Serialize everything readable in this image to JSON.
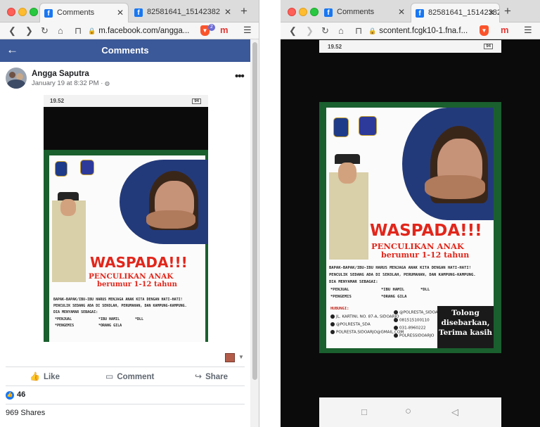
{
  "left_window": {
    "tabs": [
      {
        "label": "Comments",
        "active": true
      },
      {
        "label": "82581641_15142382",
        "active": false
      }
    ],
    "url": "m.facebook.com/angga...",
    "brave_badge": "2",
    "header_title": "Comments",
    "post": {
      "author": "Angga Saputra",
      "date": "January 19 at 8:32 PM",
      "date_separator": "·"
    },
    "actions": {
      "like": "Like",
      "comment": "Comment",
      "share": "Share"
    },
    "like_count": "46",
    "shares": "969 Shares"
  },
  "right_window": {
    "tabs": [
      {
        "label": "Comments",
        "active": false
      },
      {
        "label": "82581641_15142382",
        "active": true
      }
    ],
    "url": "scontent.fcgk10-1.fna.f..."
  },
  "phone_status": {
    "time": "19.52",
    "battery": "94"
  },
  "poster": {
    "headline": "WASPADA!!!",
    "subheadline": "PENCULIKAN ANAK",
    "age_range": "berumur 1-12 tahun",
    "body_lines": [
      "BAPAK-BAPAK/IBU-IBU HARUS MENJAGA ANAK KITA DENGAN HATI-HATI!",
      "PENCULIK SEDANG ADA DI SEKOLAH, PERUMAHAN, DAN KAMPUNG-KAMPUNG.",
      "DIA MENYAMAR SEBAGAI:"
    ],
    "disguises": [
      "*PENJUAL",
      "*IBU HAMIL",
      "*DLL",
      "*PENGEMIS",
      "*ORANG GILA"
    ],
    "contact_title": "HUBUNGI:",
    "contacts": [
      "JL. KARTINI, NO. 87-A, SIDOARJO",
      "@POLRESTA_SDA",
      "POLRESTA.SIDOARJO@GMAIL.COM",
      "@POLRESTA_SIDOARJO",
      "081515100110",
      "031-8960222",
      "POLRESSIDOARJO"
    ],
    "footer": [
      "Tolong",
      "disebarkan,",
      "Terima kasih"
    ]
  },
  "colors": {
    "facebook_blue": "#3b5998",
    "like_blue": "#1877f2",
    "poster_red": "#e2261b",
    "poster_green": "#1a5f2e"
  }
}
